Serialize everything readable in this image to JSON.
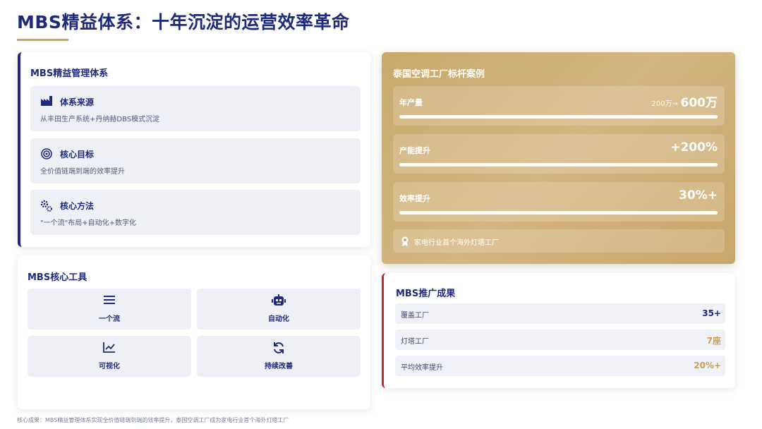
{
  "title": "MBS精益体系：十年沉淀的运营效率革命",
  "system": {
    "heading": "MBS精益管理体系",
    "items": [
      {
        "icon": "factory-icon",
        "label": "体系来源",
        "desc": "从丰田生产系统+丹纳赫DBS模式沉淀"
      },
      {
        "icon": "target-icon",
        "label": "核心目标",
        "desc": "全价值链端到端的效率提升"
      },
      {
        "icon": "gears-icon",
        "label": "核心方法",
        "desc": "\"一个流\"布局+自动化+数字化"
      }
    ]
  },
  "tools": {
    "heading": "MBS核心工具",
    "items": [
      {
        "icon": "list-icon",
        "label": "一个流"
      },
      {
        "icon": "robot-icon",
        "label": "自动化"
      },
      {
        "icon": "chart-line-icon",
        "label": "可视化"
      },
      {
        "icon": "refresh-icon",
        "label": "持续改善"
      }
    ]
  },
  "case": {
    "heading": "泰国空调工厂标杆案例",
    "metrics": [
      {
        "label": "年产量",
        "prefix": "200万→",
        "value": "600万",
        "fill": 1.0
      },
      {
        "label": "产能提升",
        "prefix": "",
        "value": "+200%",
        "fill": 1.0
      },
      {
        "label": "效率提升",
        "prefix": "",
        "value": "30%+",
        "fill": 1.0
      }
    ],
    "note": "家电行业首个海外灯塔工厂",
    "note_icon": "award-icon"
  },
  "results": {
    "heading": "MBS推广成果",
    "rows": [
      {
        "label": "覆盖工厂",
        "value": "35+",
        "color": "#1f2a7a"
      },
      {
        "label": "灯塔工厂",
        "value": "7座",
        "color": "#c9a05a"
      },
      {
        "label": "平均效率提升",
        "value": "20%+",
        "color": "#c9a05a"
      }
    ]
  },
  "footer": "核心成果：MBS精益管理体系实现全价值链端到端的效率提升，泰国空调工厂成为家电行业首个海外灯塔工厂",
  "colors": {
    "navy": "#1f2a7a",
    "gold": "#c9a96b",
    "red": "#c0282f"
  }
}
